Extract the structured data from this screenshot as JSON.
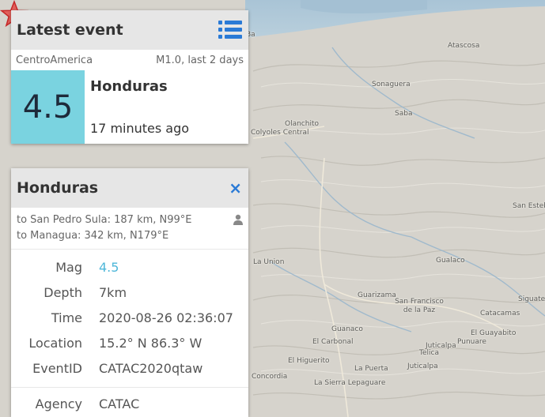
{
  "map": {
    "places": [
      {
        "name": "Ba"
      },
      {
        "name": "Atascosa"
      },
      {
        "name": "Sonaguera"
      },
      {
        "name": "Saba"
      },
      {
        "name": "Olanchito"
      },
      {
        "name": "Colyoles Central"
      },
      {
        "name": "San Esteb"
      },
      {
        "name": "La Union"
      },
      {
        "name": "Gualaco"
      },
      {
        "name": "Guarizama"
      },
      {
        "name": "San Francisco de la Paz"
      },
      {
        "name": "Siguate"
      },
      {
        "name": "Catacamas"
      },
      {
        "name": "Guanaco"
      },
      {
        "name": "El Carbonal"
      },
      {
        "name": "Juticalpa"
      },
      {
        "name": "El Guayabito"
      },
      {
        "name": "Punuare"
      },
      {
        "name": "Telica"
      },
      {
        "name": "El Higuerito"
      },
      {
        "name": "La Puerta"
      },
      {
        "name": "Juticalpa"
      },
      {
        "name": "La Sierra Lepaguare"
      },
      {
        "name": "Concordia"
      }
    ]
  },
  "latest": {
    "title": "Latest event",
    "network": "CentroAmerica",
    "summary": "M1.0, last 2 days",
    "magnitude": "4.5",
    "region": "Honduras",
    "time_ago": "17 minutes ago",
    "mag_color": "#7ad3e0"
  },
  "detail": {
    "title": "Honduras",
    "close_symbol": "×",
    "distance_1": "to San Pedro Sula: 187 km, N99°E",
    "distance_2": "to Managua: 342 km, N179°E",
    "attributes": [
      {
        "label": "Mag",
        "value": "4.5"
      },
      {
        "label": "Depth",
        "value": "7km"
      },
      {
        "label": "Time",
        "value": "2020-08-26 02:36:07"
      },
      {
        "label": "Location",
        "value": "15.2° N 86.3° W"
      },
      {
        "label": "EventID",
        "value": "CATAC2020qtaw"
      }
    ],
    "agency": {
      "label": "Agency",
      "value": "CATAC"
    }
  },
  "icons": {
    "list": "list-icon",
    "close": "close-icon",
    "person": "person-icon",
    "epicenter": "star-icon"
  },
  "colors": {
    "accent": "#2a7ad6",
    "magnitude_text": "#4fb7d9",
    "epicenter": "#e53935"
  }
}
